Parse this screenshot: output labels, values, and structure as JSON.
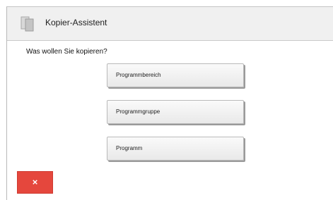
{
  "dialog": {
    "title": "Kopier-Assistent",
    "title_icon": "copy-pages-icon",
    "question": "Was wollen Sie kopieren?",
    "options": [
      {
        "label": "Programmbereich"
      },
      {
        "label": "Programmgruppe"
      },
      {
        "label": "Programm"
      }
    ],
    "cancel": {
      "glyph": "×",
      "icon": "close-icon",
      "color": "#e5473d"
    }
  }
}
